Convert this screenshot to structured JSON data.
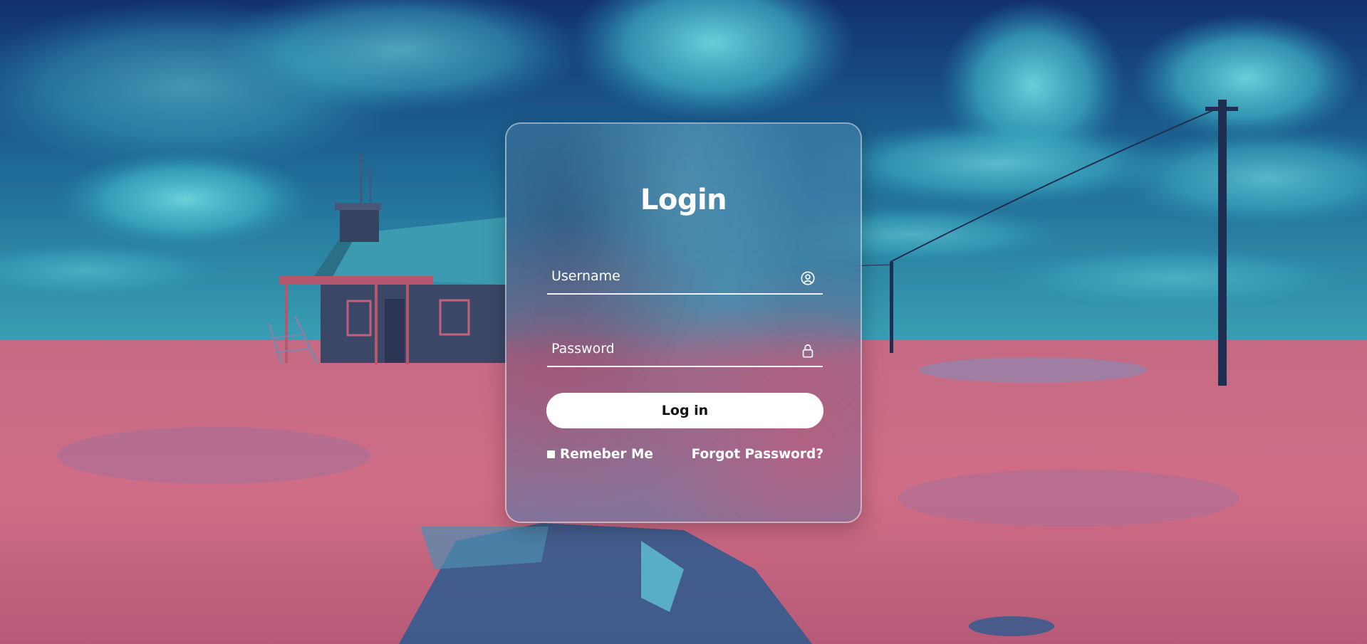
{
  "login": {
    "title": "Login",
    "username_placeholder": "Username",
    "password_placeholder": "Password",
    "submit_label": "Log in",
    "remember_label": "Remeber Me",
    "forgot_label": "Forgot Password?"
  },
  "icons": {
    "username": "user-circle-icon",
    "password": "lock-icon"
  },
  "colors": {
    "sky": "#1a4f86",
    "field": "#c9667f",
    "button": "#ffffff",
    "text": "#ffffff"
  }
}
